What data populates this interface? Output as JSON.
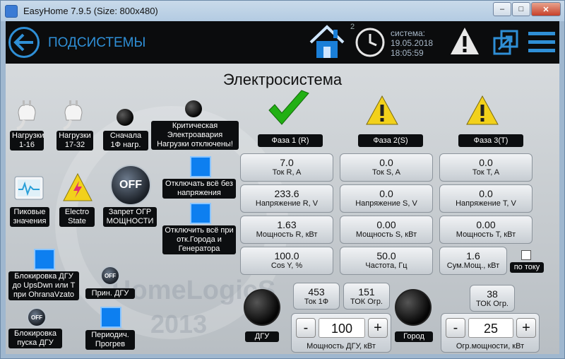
{
  "window": {
    "title": "EasyHome 7.9.5 (Size: 800x480)",
    "min": "–",
    "max": "□",
    "close": "✕"
  },
  "header": {
    "title": "ПОДСИСТЕМЫ",
    "clock_badge": "2",
    "sys_label": "система:",
    "date": "19.05.2018",
    "time": "18:05:59",
    "icons": {
      "back": "back-arrow-icon",
      "home": "home-icon",
      "clock": "clock-icon",
      "warning": "warning-icon",
      "expand": "expand-window-icon",
      "menu": "hamburger-menu-icon"
    }
  },
  "page": {
    "title": "Электросистема"
  },
  "watermark": {
    "line1": "HomeLogicS",
    "line2": "2013"
  },
  "left": {
    "loads1": "Нагрузки 1-16",
    "loads2": "Нагрузки 17-32",
    "first1f": "Сначала 1Ф нагр.",
    "critical": "Критическая Электроавария Нагрузки отключены!",
    "peak": "Пиковые значения",
    "electro": "Electro State",
    "ban_ogr": "Запрет ОГР МОЩНОСТИ",
    "off_label": "OFF",
    "disconnect_all": "Отключать всё без напряжения",
    "disconnect_city": "Отключить всё при отк.Города и Генератора",
    "block_dgu": "Блокировка ДГУ до UpsDwn или Т при OhranaVzato",
    "accept_dgu": "Прин. ДГУ",
    "block_start": "Блокировка пуска ДГУ",
    "periodic": "Периодич. Прогрев"
  },
  "phases": [
    {
      "name": "Фаза 1 (R)",
      "status": "ok",
      "current": {
        "value": "7.0",
        "caption": "Ток R, A"
      },
      "voltage": {
        "value": "233.6",
        "caption": "Напряжение R, V"
      },
      "power": {
        "value": "1.63",
        "caption": "Мощность R, кВт"
      }
    },
    {
      "name": "Фаза 2(S)",
      "status": "warning",
      "current": {
        "value": "0.0",
        "caption": "Ток S, A"
      },
      "voltage": {
        "value": "0.0",
        "caption": "Напряжение S, V"
      },
      "power": {
        "value": "0.00",
        "caption": "Мощность S, кВт"
      }
    },
    {
      "name": "Фаза 3(T)",
      "status": "warning",
      "current": {
        "value": "0.0",
        "caption": "Ток T, A"
      },
      "voltage": {
        "value": "0.0",
        "caption": "Напряжение T, V"
      },
      "power": {
        "value": "0.00",
        "caption": "Мощность T, кВт"
      }
    }
  ],
  "extra": {
    "cos": {
      "value": "100.0",
      "caption": "Cos Y, %"
    },
    "freq": {
      "value": "50.0",
      "caption": "Частота, Гц"
    },
    "sum": {
      "value": "1.6",
      "caption": "Сум.Мощ., кВт"
    },
    "by_current": "по току"
  },
  "bottom": {
    "dgu": "ДГУ",
    "city": "Город",
    "tok1f": {
      "value": "453",
      "caption": "Ток 1Ф"
    },
    "tok_ogr": {
      "value": "151",
      "caption": "ТОК Огр."
    },
    "tok_ogr2": {
      "value": "38",
      "caption": "ТОК Огр."
    },
    "dgu_power": {
      "minus": "-",
      "value": "100",
      "plus": "+",
      "caption": "Мощность ДГУ, кВт"
    },
    "ogr_power": {
      "minus": "-",
      "value": "25",
      "plus": "+",
      "caption": "Огр.мощности, кВт"
    }
  },
  "colors": {
    "accent": "#2f8fd6",
    "ok": "#22b014",
    "warning": "#f2d11b",
    "toggle": "#0d7ff0"
  }
}
